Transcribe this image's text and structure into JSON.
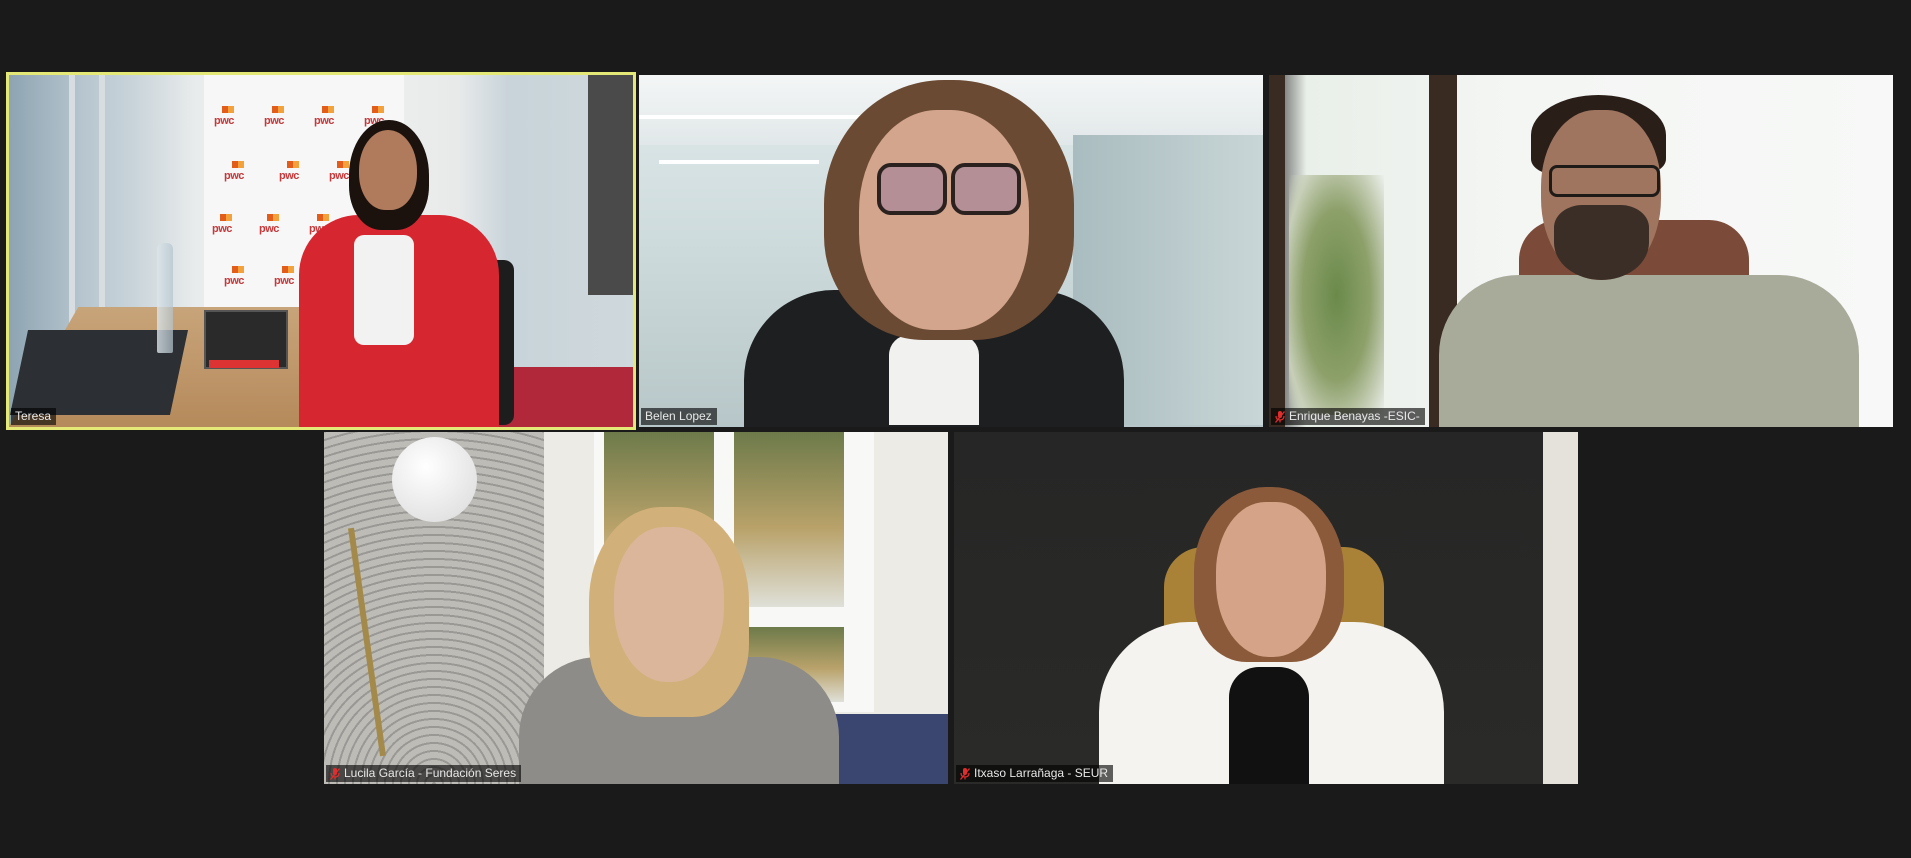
{
  "app": {
    "view": "gallery"
  },
  "participants": [
    {
      "name": "Teresa",
      "muted": false,
      "active_speaker": true
    },
    {
      "name": "Belen Lopez",
      "muted": false,
      "active_speaker": false
    },
    {
      "name": "Enrique Benayas -ESIC-",
      "muted": true,
      "active_speaker": false
    },
    {
      "name": "Lucila García - Fundación Seres",
      "muted": true,
      "active_speaker": false
    },
    {
      "name": "Itxaso Larrañaga - SEUR",
      "muted": true,
      "active_speaker": false
    }
  ],
  "logos": {
    "banner_text": "pwc"
  },
  "colors": {
    "active_border": "#e3e876",
    "background": "#1a1a1a",
    "mute_icon": "#e02d2d"
  },
  "icons": {
    "mute": "microphone-muted-icon"
  }
}
